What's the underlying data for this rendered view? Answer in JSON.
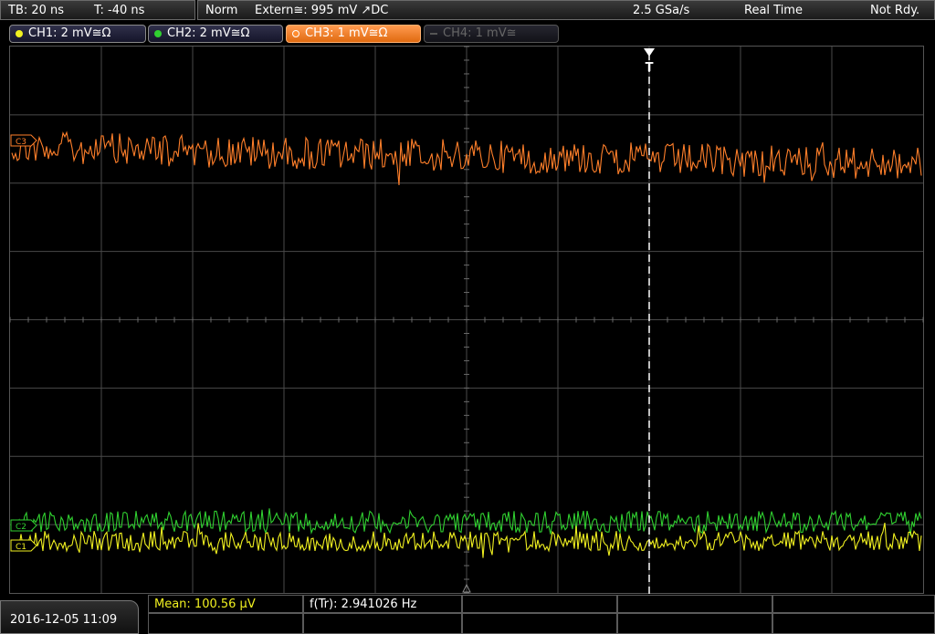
{
  "topbar": {
    "timebase": "TB: 20 ns",
    "trigger_time": "T: -40 ns",
    "mode": "Norm",
    "trigger_source": "Extern≅: 995 mV ↗DC",
    "sample_rate": "2.5 GSa/s",
    "acq_mode": "Real Time",
    "status": "Not Rdy."
  },
  "channels": [
    {
      "label": "CH1: 2 mV≅Ω",
      "color": "#f0f020",
      "active": false
    },
    {
      "label": "CH2: 2 mV≅Ω",
      "color": "#30d030",
      "active": false
    },
    {
      "label": "CH3: 1 mV≅Ω",
      "color": "#ff8c30",
      "active": true
    },
    {
      "label": "CH4: 1 mV≅",
      "color": "#707070",
      "active": false,
      "disabled": true
    }
  ],
  "markers": {
    "ch3": "C3",
    "ch2": "C2",
    "ch1": "C1",
    "trigger": "T"
  },
  "measurements": {
    "mean": "Mean: 100.56 µV",
    "freq": "f(Tr): 2.941026 Hz"
  },
  "datetime": "2016-12-05 11:09",
  "colors": {
    "ch1": "#f0f020",
    "ch2": "#30d030",
    "ch3": "#ff7f2a",
    "grid": "#4a4a4a"
  }
}
